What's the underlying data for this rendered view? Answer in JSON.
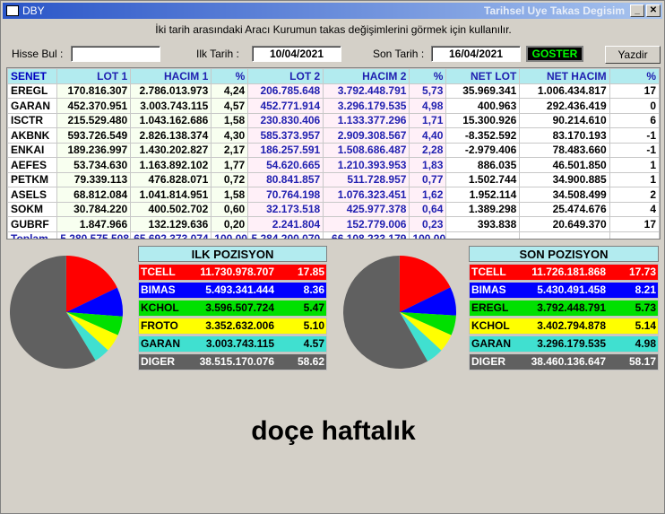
{
  "titlebar": {
    "title": "DBY",
    "right_title": "Tarihsel Uye Takas Degisim"
  },
  "subtitle": "İki tarih arasındaki  Aracı Kurumun takas değişimlerini görmek için kullanılır.",
  "form": {
    "hisse_label": "Hisse Bul :",
    "hisse_value": "",
    "ilk_label": "Ilk Tarih :",
    "ilk_value": "10/04/2021",
    "son_label": "Son Tarih :",
    "son_value": "16/04/2021",
    "goster_label": "GOSTER",
    "yazdir_label": "Yazdir"
  },
  "table": {
    "headers": [
      "SENET",
      "LOT 1",
      "HACIM 1",
      "%",
      "LOT 2",
      "HACIM 2",
      "%",
      "NET LOT",
      "NET HACIM",
      "%"
    ],
    "rows": [
      [
        "EREGL",
        "170.816.307",
        "2.786.013.973",
        "4,24",
        "206.785.648",
        "3.792.448.791",
        "5,73",
        "35.969.341",
        "1.006.434.817",
        "17"
      ],
      [
        "GARAN",
        "452.370.951",
        "3.003.743.115",
        "4,57",
        "452.771.914",
        "3.296.179.535",
        "4,98",
        "400.963",
        "292.436.419",
        "0"
      ],
      [
        "ISCTR",
        "215.529.480",
        "1.043.162.686",
        "1,58",
        "230.830.406",
        "1.133.377.296",
        "1,71",
        "15.300.926",
        "90.214.610",
        "6"
      ],
      [
        "AKBNK",
        "593.726.549",
        "2.826.138.374",
        "4,30",
        "585.373.957",
        "2.909.308.567",
        "4,40",
        "-8.352.592",
        "83.170.193",
        "-1"
      ],
      [
        "ENKAI",
        "189.236.997",
        "1.430.202.827",
        "2,17",
        "186.257.591",
        "1.508.686.487",
        "2,28",
        "-2.979.406",
        "78.483.660",
        "-1"
      ],
      [
        "AEFES",
        "53.734.630",
        "1.163.892.102",
        "1,77",
        "54.620.665",
        "1.210.393.953",
        "1,83",
        "886.035",
        "46.501.850",
        "1"
      ],
      [
        "PETKM",
        "79.339.113",
        "476.828.071",
        "0,72",
        "80.841.857",
        "511.728.957",
        "0,77",
        "1.502.744",
        "34.900.885",
        "1"
      ],
      [
        "ASELS",
        "68.812.084",
        "1.041.814.951",
        "1,58",
        "70.764.198",
        "1.076.323.451",
        "1,62",
        "1.952.114",
        "34.508.499",
        "2"
      ],
      [
        "SOKM",
        "30.784.220",
        "400.502.702",
        "0,60",
        "32.173.518",
        "425.977.378",
        "0,64",
        "1.389.298",
        "25.474.676",
        "4"
      ],
      [
        "GUBRF",
        "1.847.966",
        "132.129.636",
        "0,20",
        "2.241.804",
        "152.779.006",
        "0,23",
        "393.838",
        "20.649.370",
        "17"
      ]
    ],
    "total": [
      "Toplam",
      "5.280.575.508",
      "65.692.373.074",
      "100,00",
      "5.284.200.070",
      "66.108.233.179",
      "100,00",
      "",
      "",
      ""
    ]
  },
  "ilk": {
    "title": "ILK POZISYON",
    "rows": [
      {
        "code": "TCELL",
        "value": "11.730.978.707",
        "pct": "17.85",
        "color": "#ff0000",
        "text": "#ffffff"
      },
      {
        "code": "BIMAS",
        "value": "5.493.341.444",
        "pct": "8.36",
        "color": "#0000ff",
        "text": "#ffffff"
      },
      {
        "code": "KCHOL",
        "value": "3.596.507.724",
        "pct": "5.47",
        "color": "#00e000",
        "text": "#000000"
      },
      {
        "code": "FROTO",
        "value": "3.352.632.006",
        "pct": "5.10",
        "color": "#ffff00",
        "text": "#000000"
      },
      {
        "code": "GARAN",
        "value": "3.003.743.115",
        "pct": "4.57",
        "color": "#40e0d0",
        "text": "#000000"
      },
      {
        "code": "DIGER",
        "value": "38.515.170.076",
        "pct": "58.62",
        "color": "#606060",
        "text": "#ffffff"
      }
    ]
  },
  "son": {
    "title": "SON POZISYON",
    "rows": [
      {
        "code": "TCELL",
        "value": "11.726.181.868",
        "pct": "17.73",
        "color": "#ff0000",
        "text": "#ffffff"
      },
      {
        "code": "BIMAS",
        "value": "5.430.491.458",
        "pct": "8.21",
        "color": "#0000ff",
        "text": "#ffffff"
      },
      {
        "code": "EREGL",
        "value": "3.792.448.791",
        "pct": "5.73",
        "color": "#00e000",
        "text": "#000000"
      },
      {
        "code": "KCHOL",
        "value": "3.402.794.878",
        "pct": "5.14",
        "color": "#ffff00",
        "text": "#000000"
      },
      {
        "code": "GARAN",
        "value": "3.296.179.535",
        "pct": "4.98",
        "color": "#40e0d0",
        "text": "#000000"
      },
      {
        "code": "DIGER",
        "value": "38.460.136.647",
        "pct": "58.17",
        "color": "#606060",
        "text": "#ffffff"
      }
    ]
  },
  "caption": "doçe haftalık"
}
